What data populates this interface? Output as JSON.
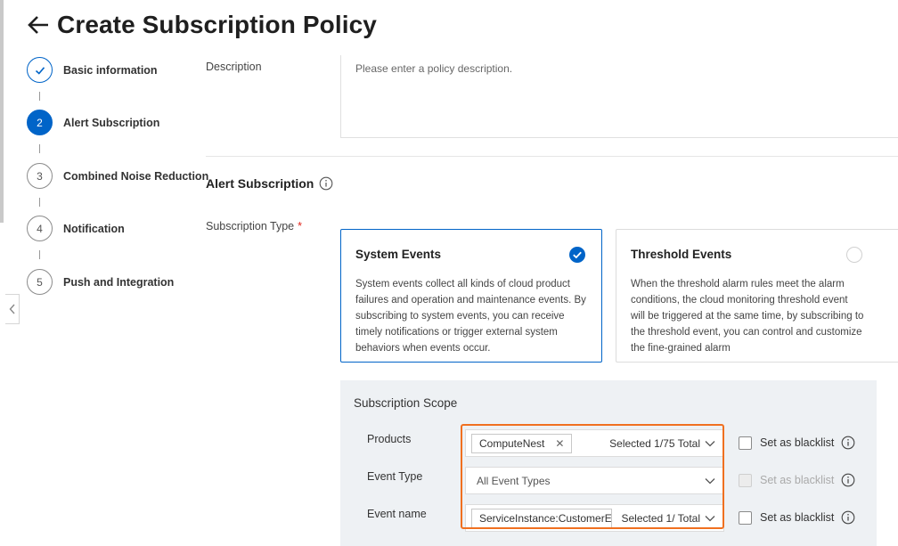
{
  "page": {
    "title": "Create Subscription Policy"
  },
  "steps": [
    {
      "number": "1",
      "label": "Basic information",
      "state": "done"
    },
    {
      "number": "2",
      "label": "Alert Subscription",
      "state": "active"
    },
    {
      "number": "3",
      "label": "Combined Noise Reduction",
      "state": "pending"
    },
    {
      "number": "4",
      "label": "Notification",
      "state": "pending"
    },
    {
      "number": "5",
      "label": "Push and Integration",
      "state": "pending"
    }
  ],
  "description": {
    "label": "Description",
    "placeholder": "Please enter a policy description."
  },
  "alert_subscription": {
    "title": "Alert Subscription",
    "type_label": "Subscription Type",
    "required_mark": "*",
    "cards": [
      {
        "title": "System Events",
        "description": "System events collect all kinds of cloud product failures and operation and maintenance events. By subscribing to system events, you can receive timely notifications or trigger external system behaviors when events occur.",
        "selected": true
      },
      {
        "title": "Threshold Events",
        "description": "When the threshold alarm rules meet the alarm conditions, the cloud monitoring threshold event will be triggered at the same time, by subscribing to the threshold event, you can control and customize the fine-grained alarm",
        "selected": false
      }
    ]
  },
  "scope": {
    "title": "Subscription Scope",
    "blacklist_label": "Set as blacklist",
    "rows": [
      {
        "label": "Products",
        "tag": "ComputeNest",
        "count": "Selected 1/75 Total",
        "blacklist_disabled": false
      },
      {
        "label": "Event Type",
        "value": "All Event Types",
        "blacklist_disabled": true
      },
      {
        "label": "Event name",
        "tag": "ServiceInstance:CustomerEve",
        "count": "Selected 1/ Total",
        "blacklist_disabled": false
      }
    ]
  },
  "colors": {
    "primary": "#0064c8",
    "highlight": "#f07020",
    "required": "#e1251b"
  }
}
